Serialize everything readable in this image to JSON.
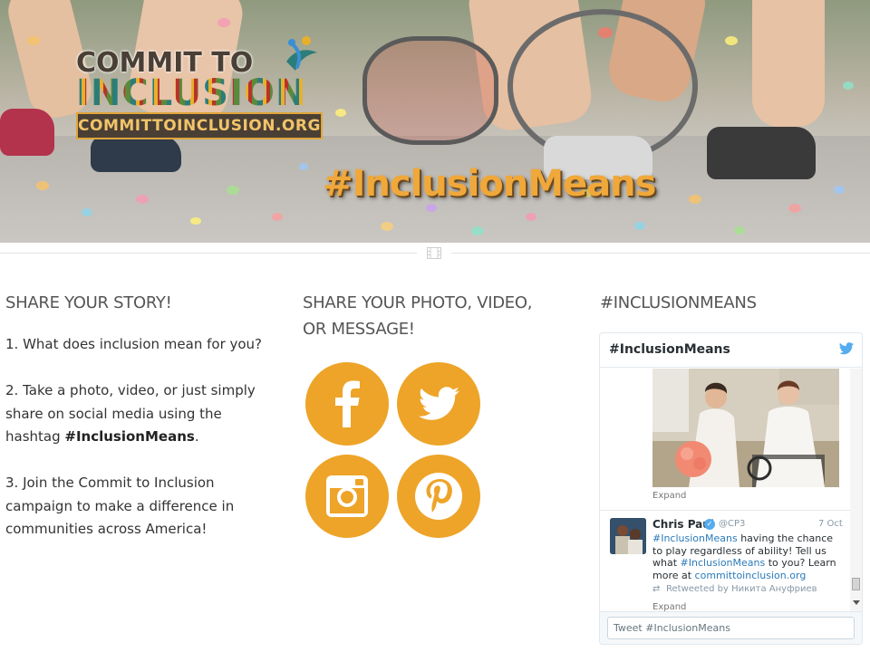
{
  "hero": {
    "logo_line1": "COMMIT TO",
    "logo_line2": "INCLUSION",
    "logo_url": "COMMITTOINCLUSION.ORG",
    "hashtag": "#InclusionMeans"
  },
  "divider": {
    "icon": "film-icon"
  },
  "story": {
    "title": "SHARE YOUR STORY!",
    "step1": "1. What does inclusion mean for you?",
    "step2_text": "2. Take a photo, video, or just simply share on social media using the hashtag ",
    "step2_tag": "#InclusionMeans",
    "step2_end": ".",
    "step3": "3. Join the Commit to Inclusion campaign to make a difference in communities across America!"
  },
  "share": {
    "title": "SHARE YOUR PHOTO, VIDEO, OR MESSAGE!",
    "icons": [
      "facebook-icon",
      "twitter-icon",
      "instagram-icon",
      "pinterest-icon"
    ],
    "color": "#eda428"
  },
  "hashtag_column": {
    "title": "#INCLUSIONMEANS"
  },
  "widget": {
    "title": "#InclusionMeans",
    "expand_label": "Expand",
    "tweet": {
      "name": "Chris Paul",
      "handle": "@CP3",
      "date": "7 Oct",
      "text_link1": "#InclusionMeans",
      "text_part1": " having the chance to play regardless of ability!  Tell us what ",
      "text_link2": "#InclusionMeans",
      "text_part2": " to you? Learn more at ",
      "text_link3": "committoinclusion.org",
      "retweeted_by": "Retweeted by Никита Ануфриев",
      "expand_label": "Expand"
    },
    "compose_placeholder": "Tweet #InclusionMeans",
    "link_color": "#2b7bb9"
  }
}
